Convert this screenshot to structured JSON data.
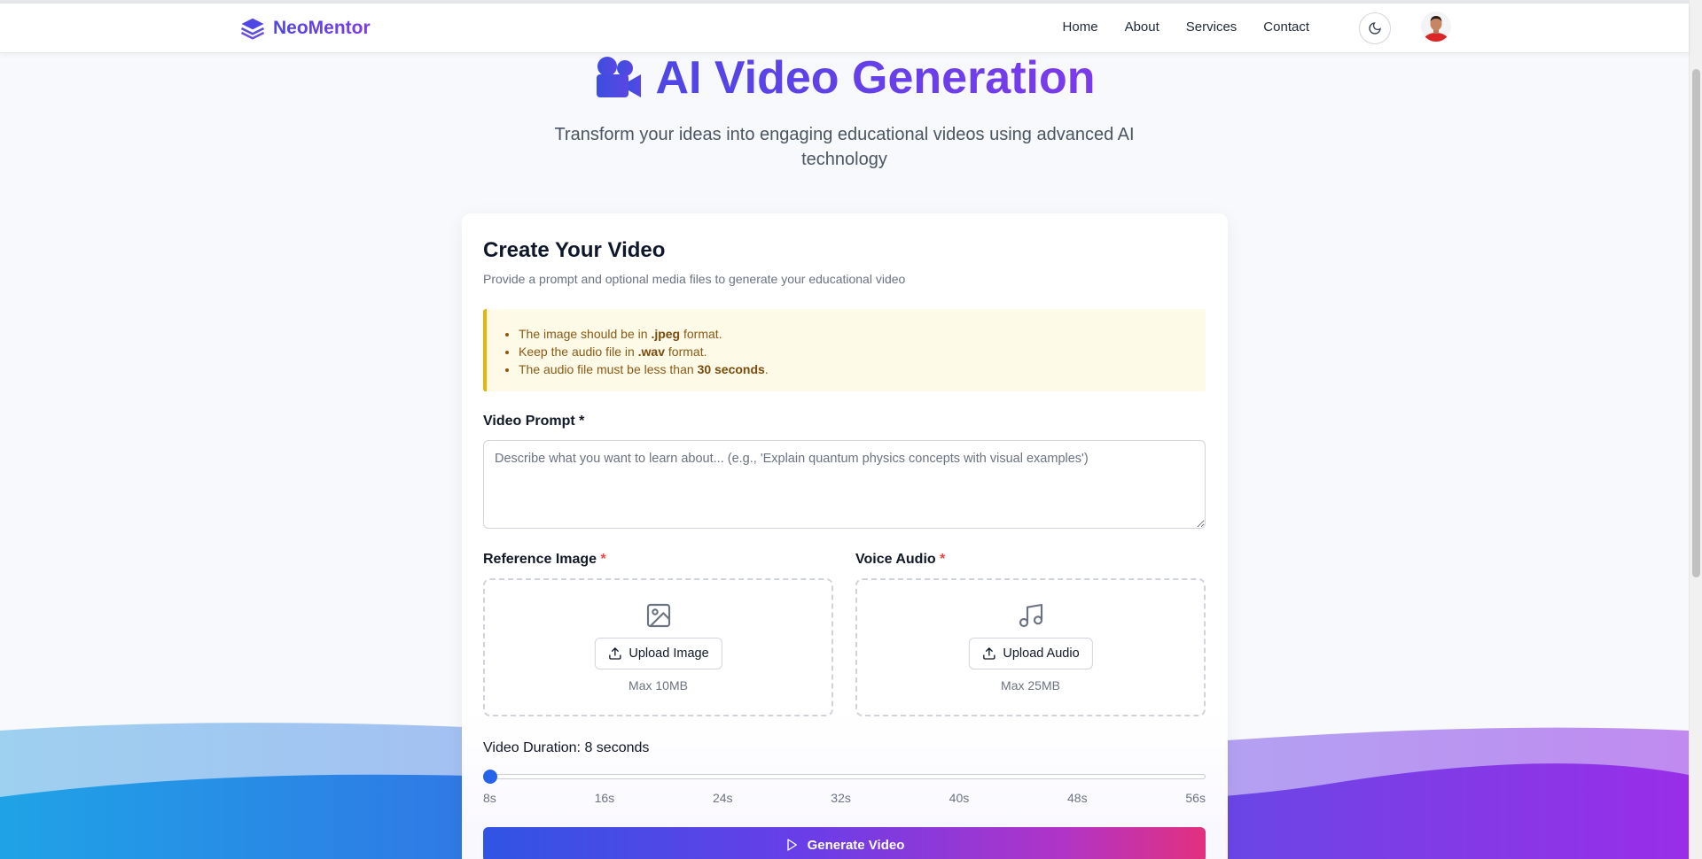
{
  "navbar": {
    "brand": "NeoMentor",
    "links": [
      "Home",
      "About",
      "Services",
      "Contact"
    ]
  },
  "hero": {
    "title": "AI Video Generation",
    "subtitle": "Transform your ideas into engaging educational videos using advanced AI technology"
  },
  "card": {
    "title": "Create Your Video",
    "description": "Provide a prompt and optional media files to generate your educational video",
    "notice": [
      {
        "pre": "The image should be in ",
        "bold": ".jpeg",
        "post": " format."
      },
      {
        "pre": "Keep the audio file in ",
        "bold": ".wav",
        "post": " format."
      },
      {
        "pre": "The audio file must be less than ",
        "bold": "30 seconds",
        "post": "."
      }
    ],
    "prompt_label": "Video Prompt *",
    "prompt_placeholder": "Describe what you want to learn about... (e.g., 'Explain quantum physics concepts with visual examples')",
    "image_label": "Reference Image",
    "image_button": "Upload Image",
    "image_limit": "Max 10MB",
    "audio_label": "Voice Audio",
    "audio_button": "Upload Audio",
    "audio_limit": "Max 25MB",
    "required_mark": "*",
    "duration_label": "Video Duration: 8 seconds",
    "duration_value": 8,
    "duration_min": 8,
    "duration_max": 56,
    "ticks": [
      "8s",
      "16s",
      "24s",
      "32s",
      "40s",
      "48s",
      "56s"
    ],
    "generate_button": "Generate Video"
  },
  "colors": {
    "brand": "#4f46e5",
    "accent": "#7c3aed",
    "slider_thumb": "#2563eb",
    "notice_border": "#eab308",
    "required": "#ef4444"
  }
}
